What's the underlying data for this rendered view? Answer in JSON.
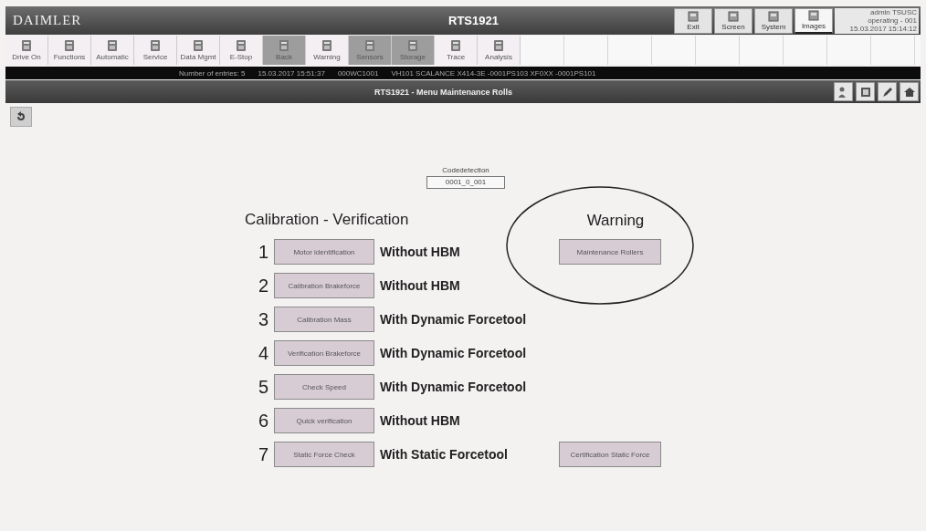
{
  "header": {
    "logo": "DAIMLER",
    "title": "RTS1921",
    "buttons": [
      {
        "label": "Exit",
        "active": false
      },
      {
        "label": "Screen",
        "active": false
      },
      {
        "label": "System",
        "active": false
      },
      {
        "label": "Images",
        "active": true
      }
    ],
    "user_info": [
      "admin TSUSC",
      "operating - 001",
      "15.03.2017 15:14:12"
    ]
  },
  "toolbar": [
    {
      "label": "Drive On",
      "active": false
    },
    {
      "label": "Functions",
      "active": false
    },
    {
      "label": "Automatic",
      "active": false
    },
    {
      "label": "Service",
      "active": false
    },
    {
      "label": "Data Mgmt",
      "active": false
    },
    {
      "label": "E-Stop",
      "active": false
    },
    {
      "label": "Back",
      "active": true
    },
    {
      "label": "Warning",
      "active": false
    },
    {
      "label": "Sensors",
      "active": true
    },
    {
      "label": "Storage",
      "active": true
    },
    {
      "label": "Trace",
      "active": false
    },
    {
      "label": "Analysis",
      "active": false
    }
  ],
  "status_bar": [
    "Number of entries: 5",
    "15.03.2017 15:51:37",
    "000WC1001",
    "VH101 SCALANCE X414-3E -0001PS103 XF0XX -0001PS101"
  ],
  "page_title": "RTS1921 - Menu Maintenance Rolls",
  "code_detection": {
    "label": "Codedetection",
    "value": "0001_0_001"
  },
  "calibration_heading": "Calibration - Verification",
  "warning_heading": "Warning",
  "rows": [
    {
      "number": "1",
      "button": "Motor identification",
      "description": "Without HBM",
      "extra": "Maintenance Rollers"
    },
    {
      "number": "2",
      "button": "Calibration Brakeforce",
      "description": "Without HBM"
    },
    {
      "number": "3",
      "button": "Calibration Mass",
      "description": "With Dynamic Forcetool"
    },
    {
      "number": "4",
      "button": "Verification Brakeforce",
      "description": "With Dynamic Forcetool"
    },
    {
      "number": "5",
      "button": "Check Speed",
      "description": "With Dynamic Forcetool"
    },
    {
      "number": "6",
      "button": "Quick verification",
      "description": "Without HBM"
    },
    {
      "number": "7",
      "button": "Static Force Check",
      "description": "With Static Forcetool",
      "extra": "Certification Static Force"
    }
  ]
}
